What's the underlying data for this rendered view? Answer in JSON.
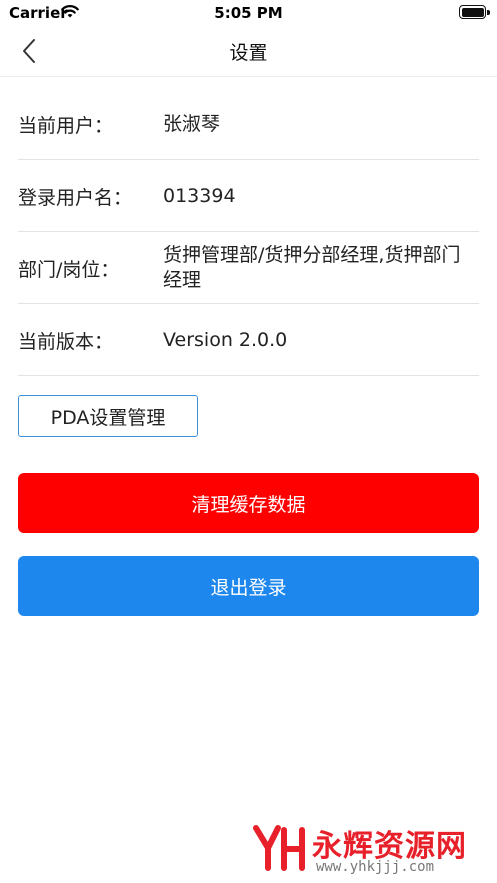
{
  "status_bar": {
    "carrier": "Carrier",
    "time": "5:05 PM",
    "wifi_icon": "wifi-icon",
    "battery_icon": "battery-icon"
  },
  "nav": {
    "title": "设置",
    "back_icon": "chevron-left-icon"
  },
  "info": {
    "rows": [
      {
        "label": "当前用户：",
        "value": "张淑琴"
      },
      {
        "label": "登录用户名：",
        "value": "013394"
      },
      {
        "label": "部门/岗位：",
        "value": "货押管理部/货押分部经理,货押部门经理"
      },
      {
        "label": "当前版本：",
        "value": "Version 2.0.0"
      }
    ]
  },
  "buttons": {
    "pda_settings": "PDA设置管理",
    "clear_cache": "清理缓存数据",
    "logout": "退出登录"
  },
  "watermark": {
    "name": "永辉资源网",
    "url": "www.yhkjjj.com"
  },
  "colors": {
    "clear_cache_bg": "#ff0000",
    "logout_bg": "#1d87ee",
    "pda_border": "#3a8fd8",
    "watermark_red": "#e8202a"
  }
}
